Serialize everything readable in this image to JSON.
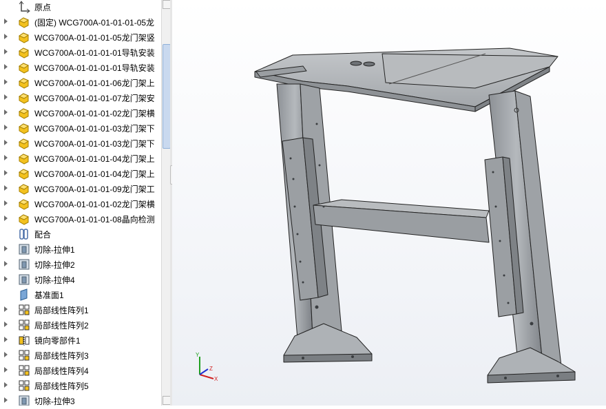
{
  "feature_tree": {
    "items": [
      {
        "label": "原点",
        "icon": "origin-icon",
        "expandable": false
      },
      {
        "label": "(固定) WCG700A-01-01-01-05龙",
        "icon": "part-icon",
        "expandable": true
      },
      {
        "label": "WCG700A-01-01-01-05龙门架竖",
        "icon": "part-icon",
        "expandable": true
      },
      {
        "label": "WCG700A-01-01-01-01导轨安装",
        "icon": "part-icon",
        "expandable": true
      },
      {
        "label": "WCG700A-01-01-01-01导轨安装",
        "icon": "part-icon",
        "expandable": true
      },
      {
        "label": "WCG700A-01-01-01-06龙门架上",
        "icon": "part-icon",
        "expandable": true
      },
      {
        "label": "WCG700A-01-01-01-07龙门架安",
        "icon": "part-icon",
        "expandable": true
      },
      {
        "label": "WCG700A-01-01-01-02龙门架横",
        "icon": "part-icon",
        "expandable": true
      },
      {
        "label": "WCG700A-01-01-01-03龙门架下",
        "icon": "part-icon",
        "expandable": true
      },
      {
        "label": "WCG700A-01-01-01-03龙门架下",
        "icon": "part-icon",
        "expandable": true
      },
      {
        "label": "WCG700A-01-01-01-04龙门架上",
        "icon": "part-icon",
        "expandable": true
      },
      {
        "label": "WCG700A-01-01-01-04龙门架上",
        "icon": "part-icon",
        "expandable": true
      },
      {
        "label": "WCG700A-01-01-01-09龙门架工",
        "icon": "part-icon",
        "expandable": true
      },
      {
        "label": "WCG700A-01-01-01-02龙门架横",
        "icon": "part-icon",
        "expandable": true
      },
      {
        "label": "WCG700A-01-01-01-08晶向检测",
        "icon": "part-icon",
        "expandable": true
      },
      {
        "label": "配合",
        "icon": "mates-icon",
        "expandable": false
      },
      {
        "label": "切除-拉伸1",
        "icon": "cut-extrude-icon",
        "expandable": true
      },
      {
        "label": "切除-拉伸2",
        "icon": "cut-extrude-icon",
        "expandable": true
      },
      {
        "label": "切除-拉伸4",
        "icon": "cut-extrude-icon",
        "expandable": true
      },
      {
        "label": "基准面1",
        "icon": "plane-icon",
        "expandable": false
      },
      {
        "label": "局部线性阵列1",
        "icon": "linear-pattern-icon",
        "expandable": true
      },
      {
        "label": "局部线性阵列2",
        "icon": "linear-pattern-icon",
        "expandable": true
      },
      {
        "label": "镜向零部件1",
        "icon": "mirror-component-icon",
        "expandable": true
      },
      {
        "label": "局部线性阵列3",
        "icon": "linear-pattern-icon",
        "expandable": true
      },
      {
        "label": "局部线性阵列4",
        "icon": "linear-pattern-icon",
        "expandable": true
      },
      {
        "label": "局部线性阵列5",
        "icon": "linear-pattern-icon",
        "expandable": true
      },
      {
        "label": "切除-拉伸3",
        "icon": "cut-extrude-icon",
        "expandable": true
      }
    ]
  },
  "triad": {
    "x": "X",
    "y": "Y",
    "z": "Z"
  },
  "colors": {
    "part_yellow": "#f3c11e",
    "model_gray": "#a8acb0",
    "triad_x": "#d02020",
    "triad_y": "#20a020",
    "triad_z": "#2030d0"
  }
}
